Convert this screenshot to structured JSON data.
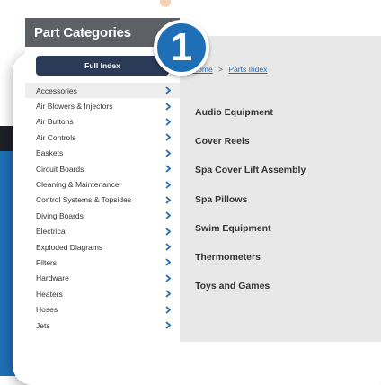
{
  "badge": {
    "number": "1"
  },
  "breadcrumb": {
    "home": "Home",
    "separator": ">",
    "current": "Parts Index"
  },
  "sidebar": {
    "title": "Part Categories",
    "full_index_label": "Full Index",
    "items": [
      {
        "label": "Accessories"
      },
      {
        "label": "Air Blowers & Injectors"
      },
      {
        "label": "Air Buttons"
      },
      {
        "label": "Air Controls"
      },
      {
        "label": "Baskets"
      },
      {
        "label": "Circuit Boards"
      },
      {
        "label": "Cleaning & Maintenance"
      },
      {
        "label": "Control Systems & Topsides"
      },
      {
        "label": "Diving Boards"
      },
      {
        "label": "Electrical"
      },
      {
        "label": "Exploded Diagrams"
      },
      {
        "label": "Filters"
      },
      {
        "label": "Hardware"
      },
      {
        "label": "Heaters"
      },
      {
        "label": "Hoses"
      },
      {
        "label": "Jets"
      }
    ]
  },
  "main": {
    "categories": [
      {
        "label": "Audio Equipment"
      },
      {
        "label": "Cover Reels"
      },
      {
        "label": "Spa Cover Lift Assembly"
      },
      {
        "label": "Spa Pillows"
      },
      {
        "label": "Swim Equipment"
      },
      {
        "label": "Thermometers"
      },
      {
        "label": "Toys and Games"
      }
    ]
  },
  "colors": {
    "accent_blue": "#1e6fb6",
    "header_gray": "#5d6166",
    "button_navy": "#2a3a57",
    "link_blue": "#1f6fc0"
  }
}
